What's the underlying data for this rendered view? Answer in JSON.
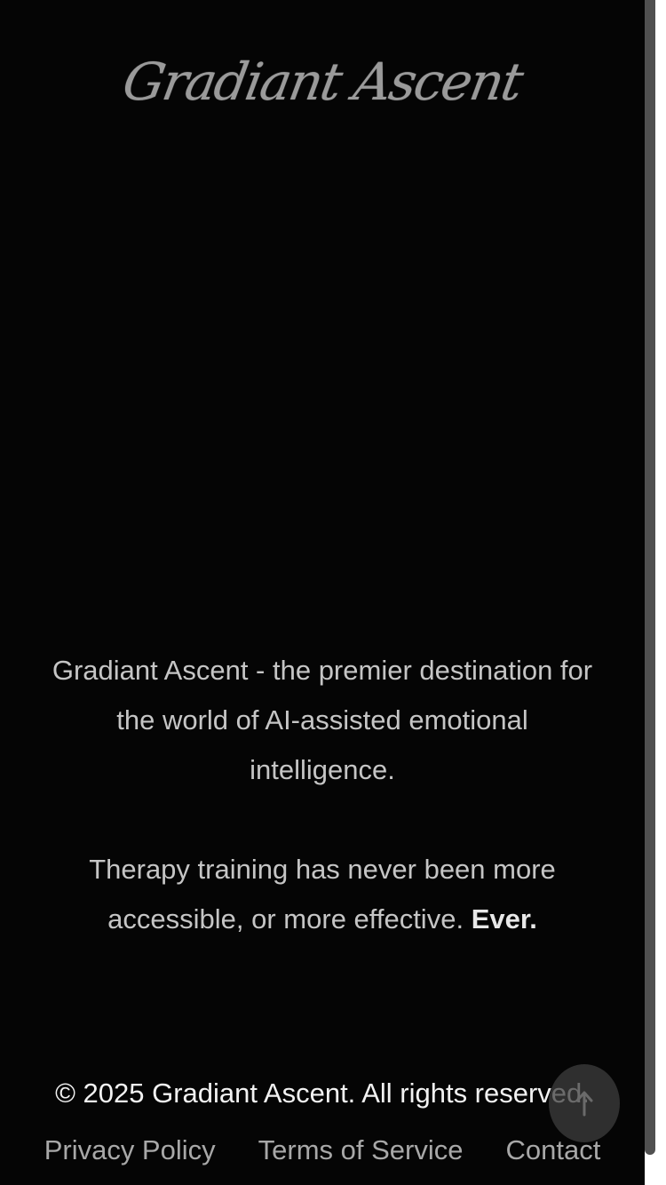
{
  "header": {
    "logo_text": "Gradiant Ascent"
  },
  "main": {
    "intro": "Gradiant Ascent - the premier destination for the world of AI-assisted emotional intelligence.",
    "pitch": "Therapy training has never been more accessible, or more effective.",
    "pitch_emphasis": "Ever."
  },
  "footer": {
    "copyright": "© 2025 Gradiant Ascent. All rights reserved.",
    "links": [
      {
        "label": "Privacy Policy"
      },
      {
        "label": "Terms of Service"
      },
      {
        "label": "Contact"
      }
    ]
  },
  "back_to_top": {
    "icon": "arrow-up-icon"
  },
  "colors": {
    "background": "#050505",
    "text": "#c5c5c5",
    "logo": "#9a9a9a",
    "link": "#a8a8a8"
  }
}
